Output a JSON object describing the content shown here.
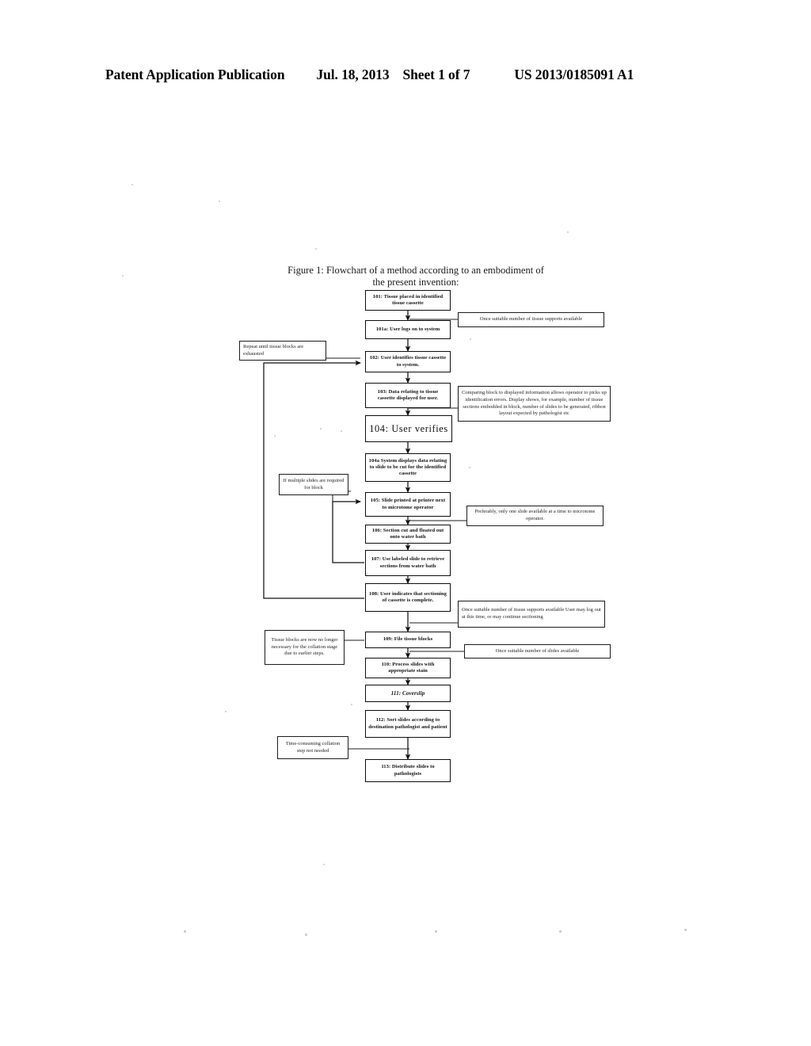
{
  "header": {
    "publication": "Patent Application Publication",
    "date": "Jul. 18, 2013",
    "sheet": "Sheet 1 of 7",
    "number": "US 2013/0185091 A1"
  },
  "figure": {
    "caption_line1": "Figure 1: Flowchart of a method according to an embodiment of",
    "caption_line2": "the present invention:"
  },
  "flowchart": {
    "nodes": [
      {
        "id": "n101",
        "label": "101: Tissue placed in identified tissue cassette"
      },
      {
        "id": "n101a",
        "label": "101a: User logs on to system"
      },
      {
        "id": "n102",
        "label": "102: User identifies tissue cassette to system."
      },
      {
        "id": "n103",
        "label": "103: Data relating to tissue cassette displayed for user."
      },
      {
        "id": "n104",
        "label": "104:  User  verifies"
      },
      {
        "id": "n104a",
        "label": "104a System displays data relating to slide to be cut for the identified cassette"
      },
      {
        "id": "n105",
        "label": "105: Slide printed at printer next to microtome operator"
      },
      {
        "id": "n106",
        "label": "106: Section cut and floated out onto water bath"
      },
      {
        "id": "n107",
        "label": "107: Use labeled slide to retrieve sections from water bath"
      },
      {
        "id": "n108",
        "label": "108:  User indicates that sectioning of cassette is complete."
      },
      {
        "id": "n109",
        "label": "109: File tissue blocks"
      },
      {
        "id": "n110",
        "label": "110: Process slides with appropriate stain"
      },
      {
        "id": "n111",
        "label": "111: Coverslip"
      },
      {
        "id": "n112",
        "label": "112: Sort slides according to destination pathologist and patient"
      },
      {
        "id": "n113",
        "label": "113: Distribute slides to pathologists"
      }
    ],
    "annotations": [
      {
        "id": "a1",
        "text": "Once suitable number of tissue supports available"
      },
      {
        "id": "a2",
        "text": "Repeat until tissue blocks are exhausted"
      },
      {
        "id": "a3",
        "text": "Comparing block to displayed information allows operator to picks up identification errors. Display shows, for example, number of tissue sections embodded in block, number of slides to be generated, ribbon layout expected by pathologist etc"
      },
      {
        "id": "a4",
        "text": "If multiple slides are required for block"
      },
      {
        "id": "a5",
        "text": "Preferably, only one slide available at a time to microtome operator."
      },
      {
        "id": "a6",
        "text": "Once suitable number of tissue supports available User may log out at this time, or may continue sectioning"
      },
      {
        "id": "a7",
        "text": "Tissue blocks are now no longer necessary for the collation stage due to earlier steps."
      },
      {
        "id": "a8",
        "text": "Once suitable number of slides available"
      },
      {
        "id": "a9",
        "text": "Time-consuming collation step not needed"
      }
    ]
  }
}
